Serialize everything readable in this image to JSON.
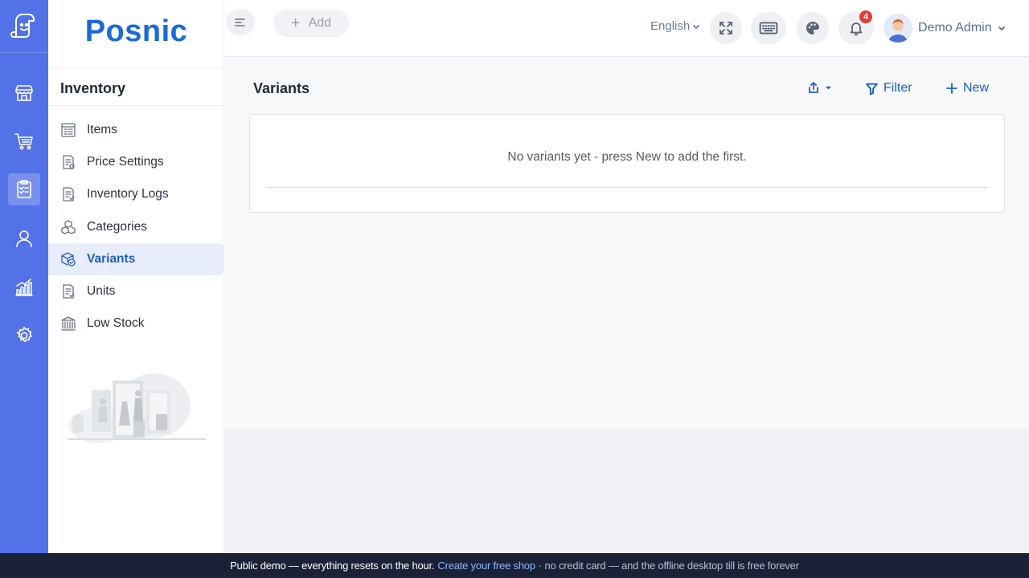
{
  "brand": {
    "name": "Posnic"
  },
  "rail": {
    "items": [
      {
        "icon": "store-icon",
        "active": false
      },
      {
        "icon": "cart-icon",
        "active": false
      },
      {
        "icon": "clipboard-icon",
        "active": true
      },
      {
        "icon": "user-icon",
        "active": false
      },
      {
        "icon": "analytics-icon",
        "active": false
      },
      {
        "icon": "gear-icon",
        "active": false
      }
    ]
  },
  "sidebar": {
    "title": "Inventory",
    "items": [
      {
        "label": "Items",
        "icon": "items-list-icon",
        "active": false
      },
      {
        "label": "Price Settings",
        "icon": "price-doc-icon",
        "active": false
      },
      {
        "label": "Inventory Logs",
        "icon": "log-doc-icon",
        "active": false
      },
      {
        "label": "Categories",
        "icon": "cubes-icon",
        "active": false
      },
      {
        "label": "Variants",
        "icon": "variant-cube-icon",
        "active": true
      },
      {
        "label": "Units",
        "icon": "units-doc-icon",
        "active": false
      },
      {
        "label": "Low Stock",
        "icon": "bank-icon",
        "active": false
      }
    ]
  },
  "topbar": {
    "add_label": "Add",
    "language": "English",
    "notification_count": "4",
    "user_name": "Demo Admin"
  },
  "main": {
    "title": "Variants",
    "filter_label": "Filter",
    "new_label": "New",
    "empty_message": "No variants yet - press New to add the first."
  },
  "footer": {
    "text1": "Public demo — everything resets on the hour.",
    "link": "Create your free shop",
    "text2": "· no credit card — and the offline desktop till is free forever"
  },
  "colors": {
    "rail": "#5472e8",
    "brand": "#1a6bd4",
    "accent": "#1f5fc4",
    "active_bg": "#e8edfb",
    "footer": "#1b2238",
    "badge": "#e53935"
  }
}
